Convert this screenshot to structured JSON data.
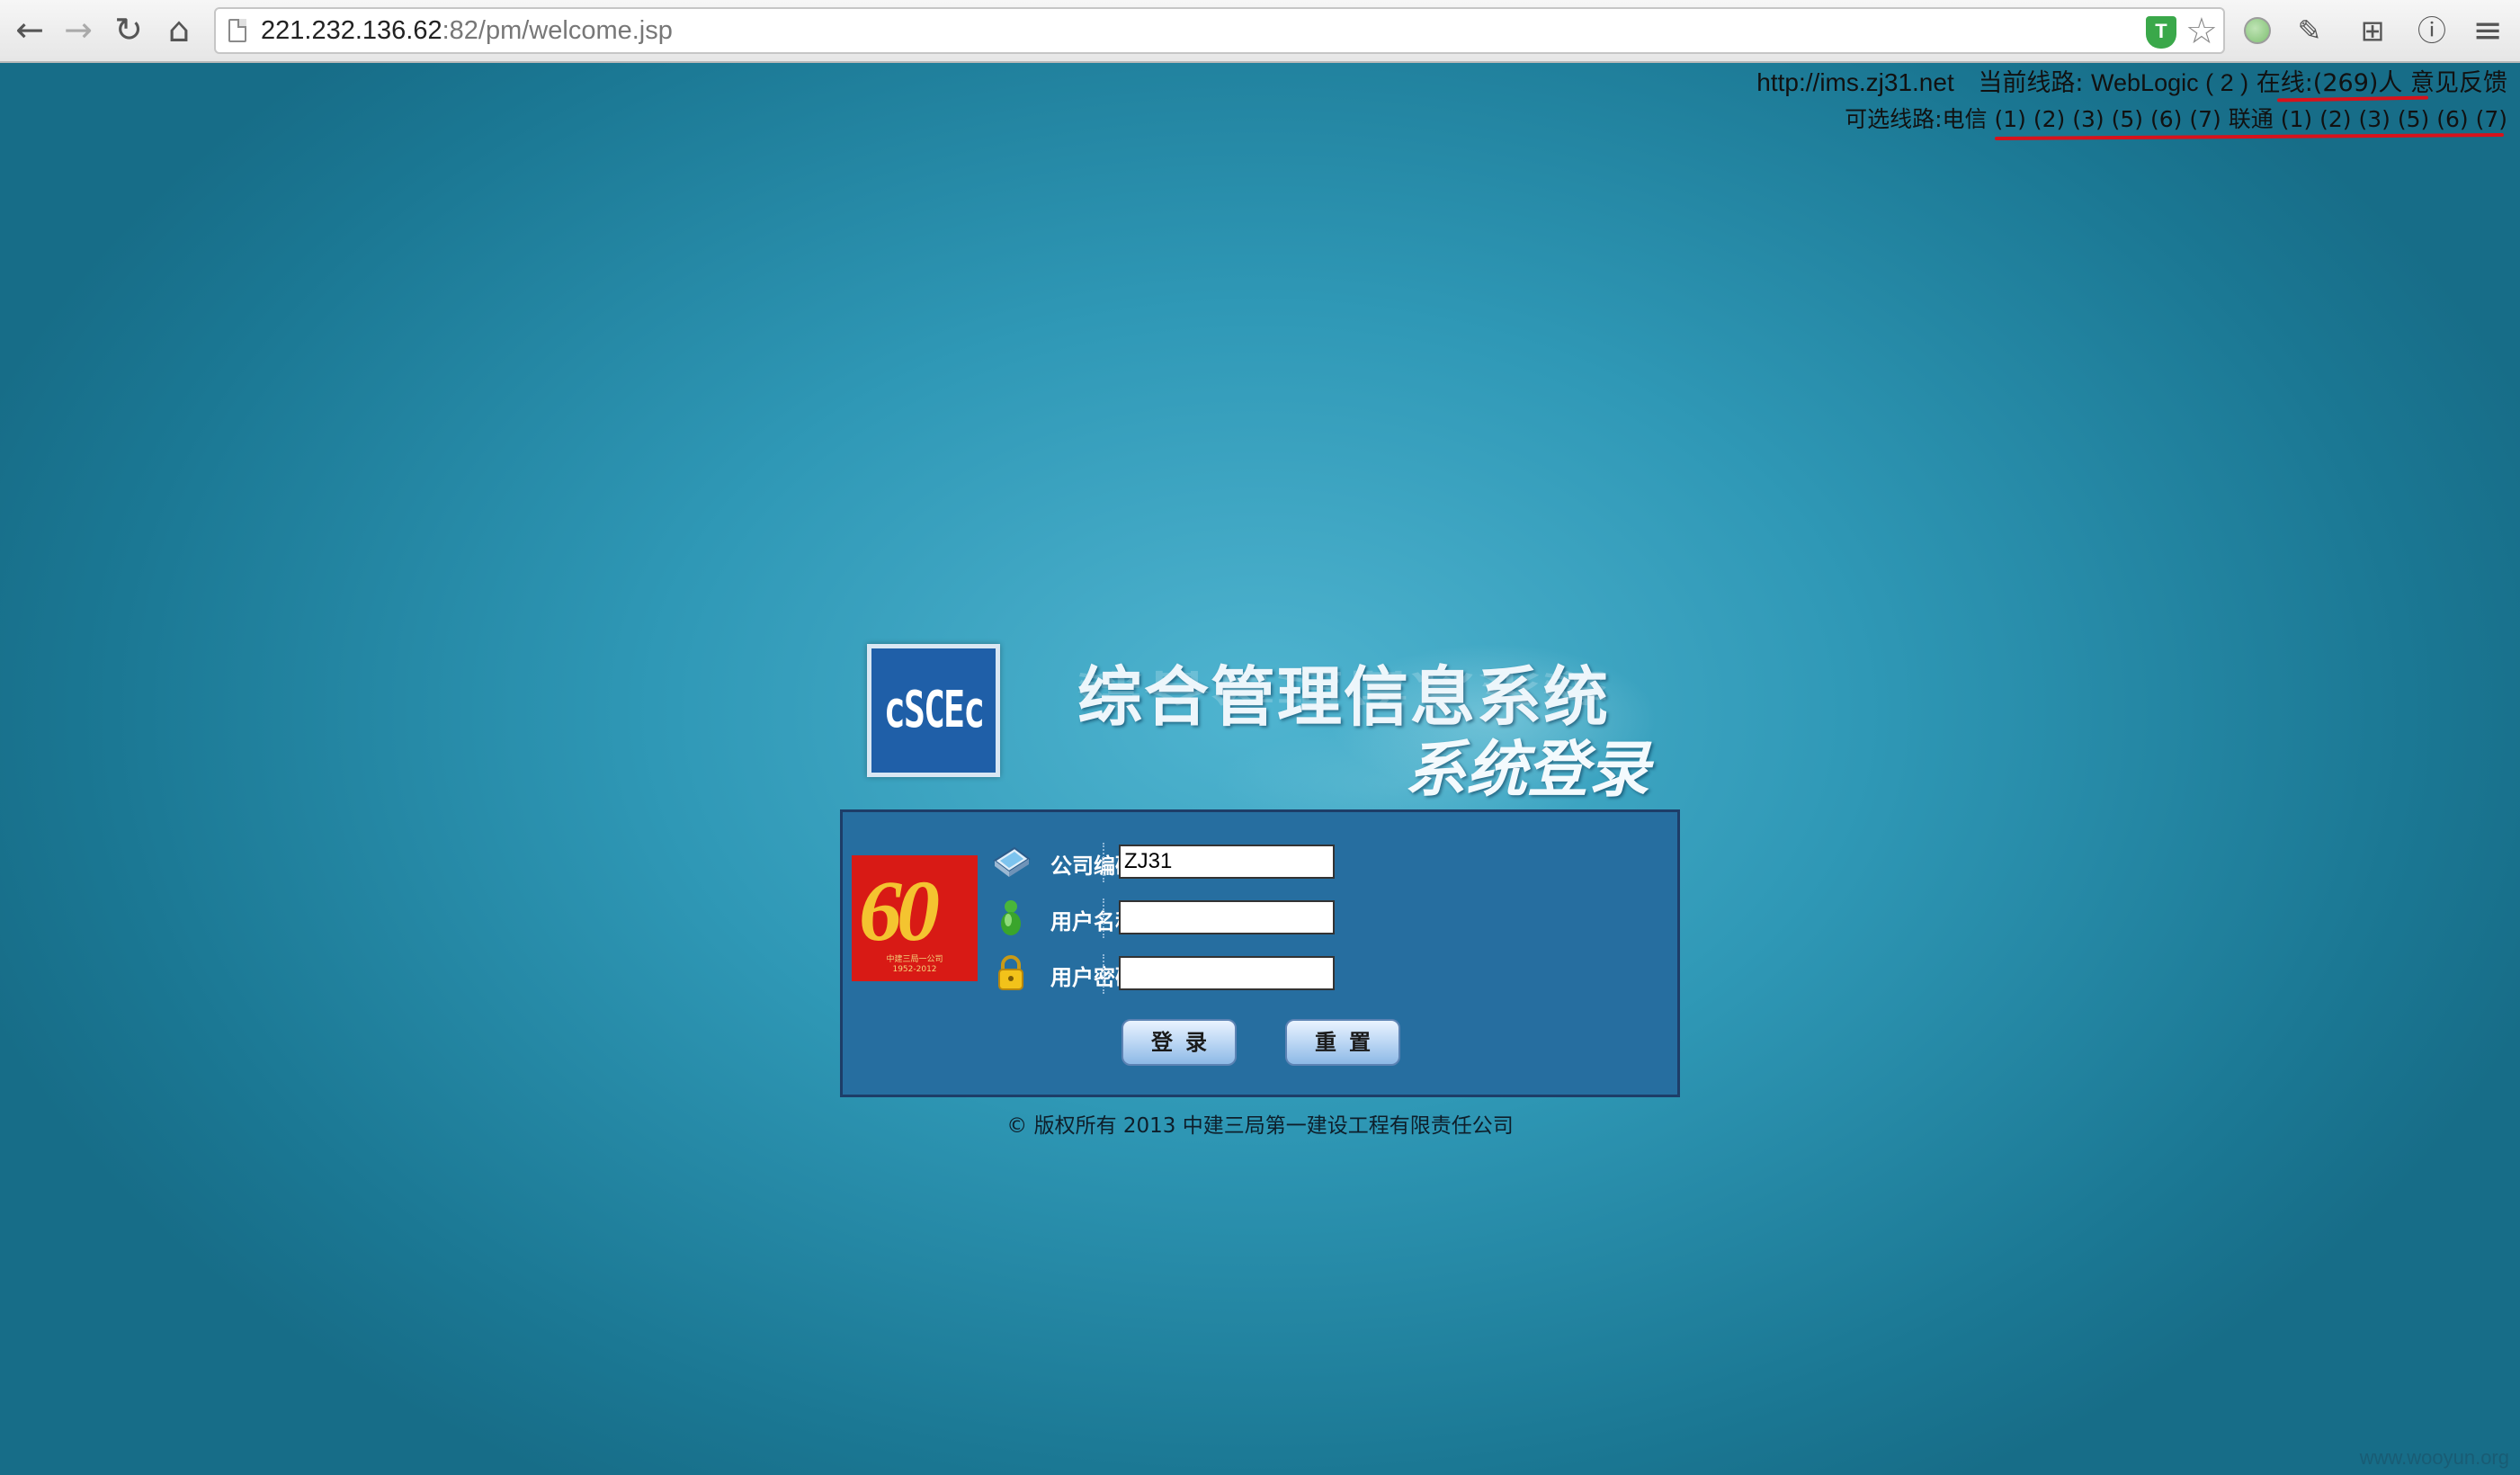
{
  "browser": {
    "back_glyph": "←",
    "forward_glyph": "→",
    "reload_glyph": "↻",
    "home_glyph": "⌂",
    "url_host": "221.232.136.62",
    "url_rest": ":82/pm/welcome.jsp",
    "shield_glyph": "T",
    "star_glyph": "☆",
    "ext1_glyph": "✎",
    "ext2_glyph": "⊞",
    "info_glyph": "ⓘ",
    "menu_glyph": "≡"
  },
  "topinfo": {
    "site_link": "http://ims.zj31.net",
    "current_line_label": "当前线路:",
    "current_line_value": "WebLogic ( 2 )",
    "online": "在线:(269)人",
    "feedback": "意见反馈",
    "optional_label": "可选线路:",
    "telecom_label": "电信",
    "telecom_lines": [
      "(1)",
      "(2)",
      "(3)",
      "(5)",
      "(6)",
      "(7)"
    ],
    "unicom_label": "联通",
    "unicom_lines": [
      "(1)",
      "(2)",
      "(3)",
      "(5)",
      "(6)",
      "(7)"
    ]
  },
  "banner": {
    "logo_text": "cSCEc",
    "title": "综合管理信息系统",
    "subtitle": "系统登录"
  },
  "login": {
    "emblem_number": "60",
    "emblem_line1": "中建三局一公司",
    "emblem_line2": "1952-2012",
    "company_label": "公司编码:",
    "company_value": "ZJ31",
    "username_label": "用户名称:",
    "username_value": "",
    "password_label": "用户密码:",
    "password_value": "",
    "login_button": "登录",
    "reset_button": "重置"
  },
  "footer": {
    "copyright": "© 版权所有 2013 中建三局第一建设工程有限责任公司"
  },
  "watermark": "www.wooyun.org",
  "colors": {
    "background": "#2f98b6",
    "login_panel": "#266ea0",
    "annotation_red": "#d8121b"
  }
}
